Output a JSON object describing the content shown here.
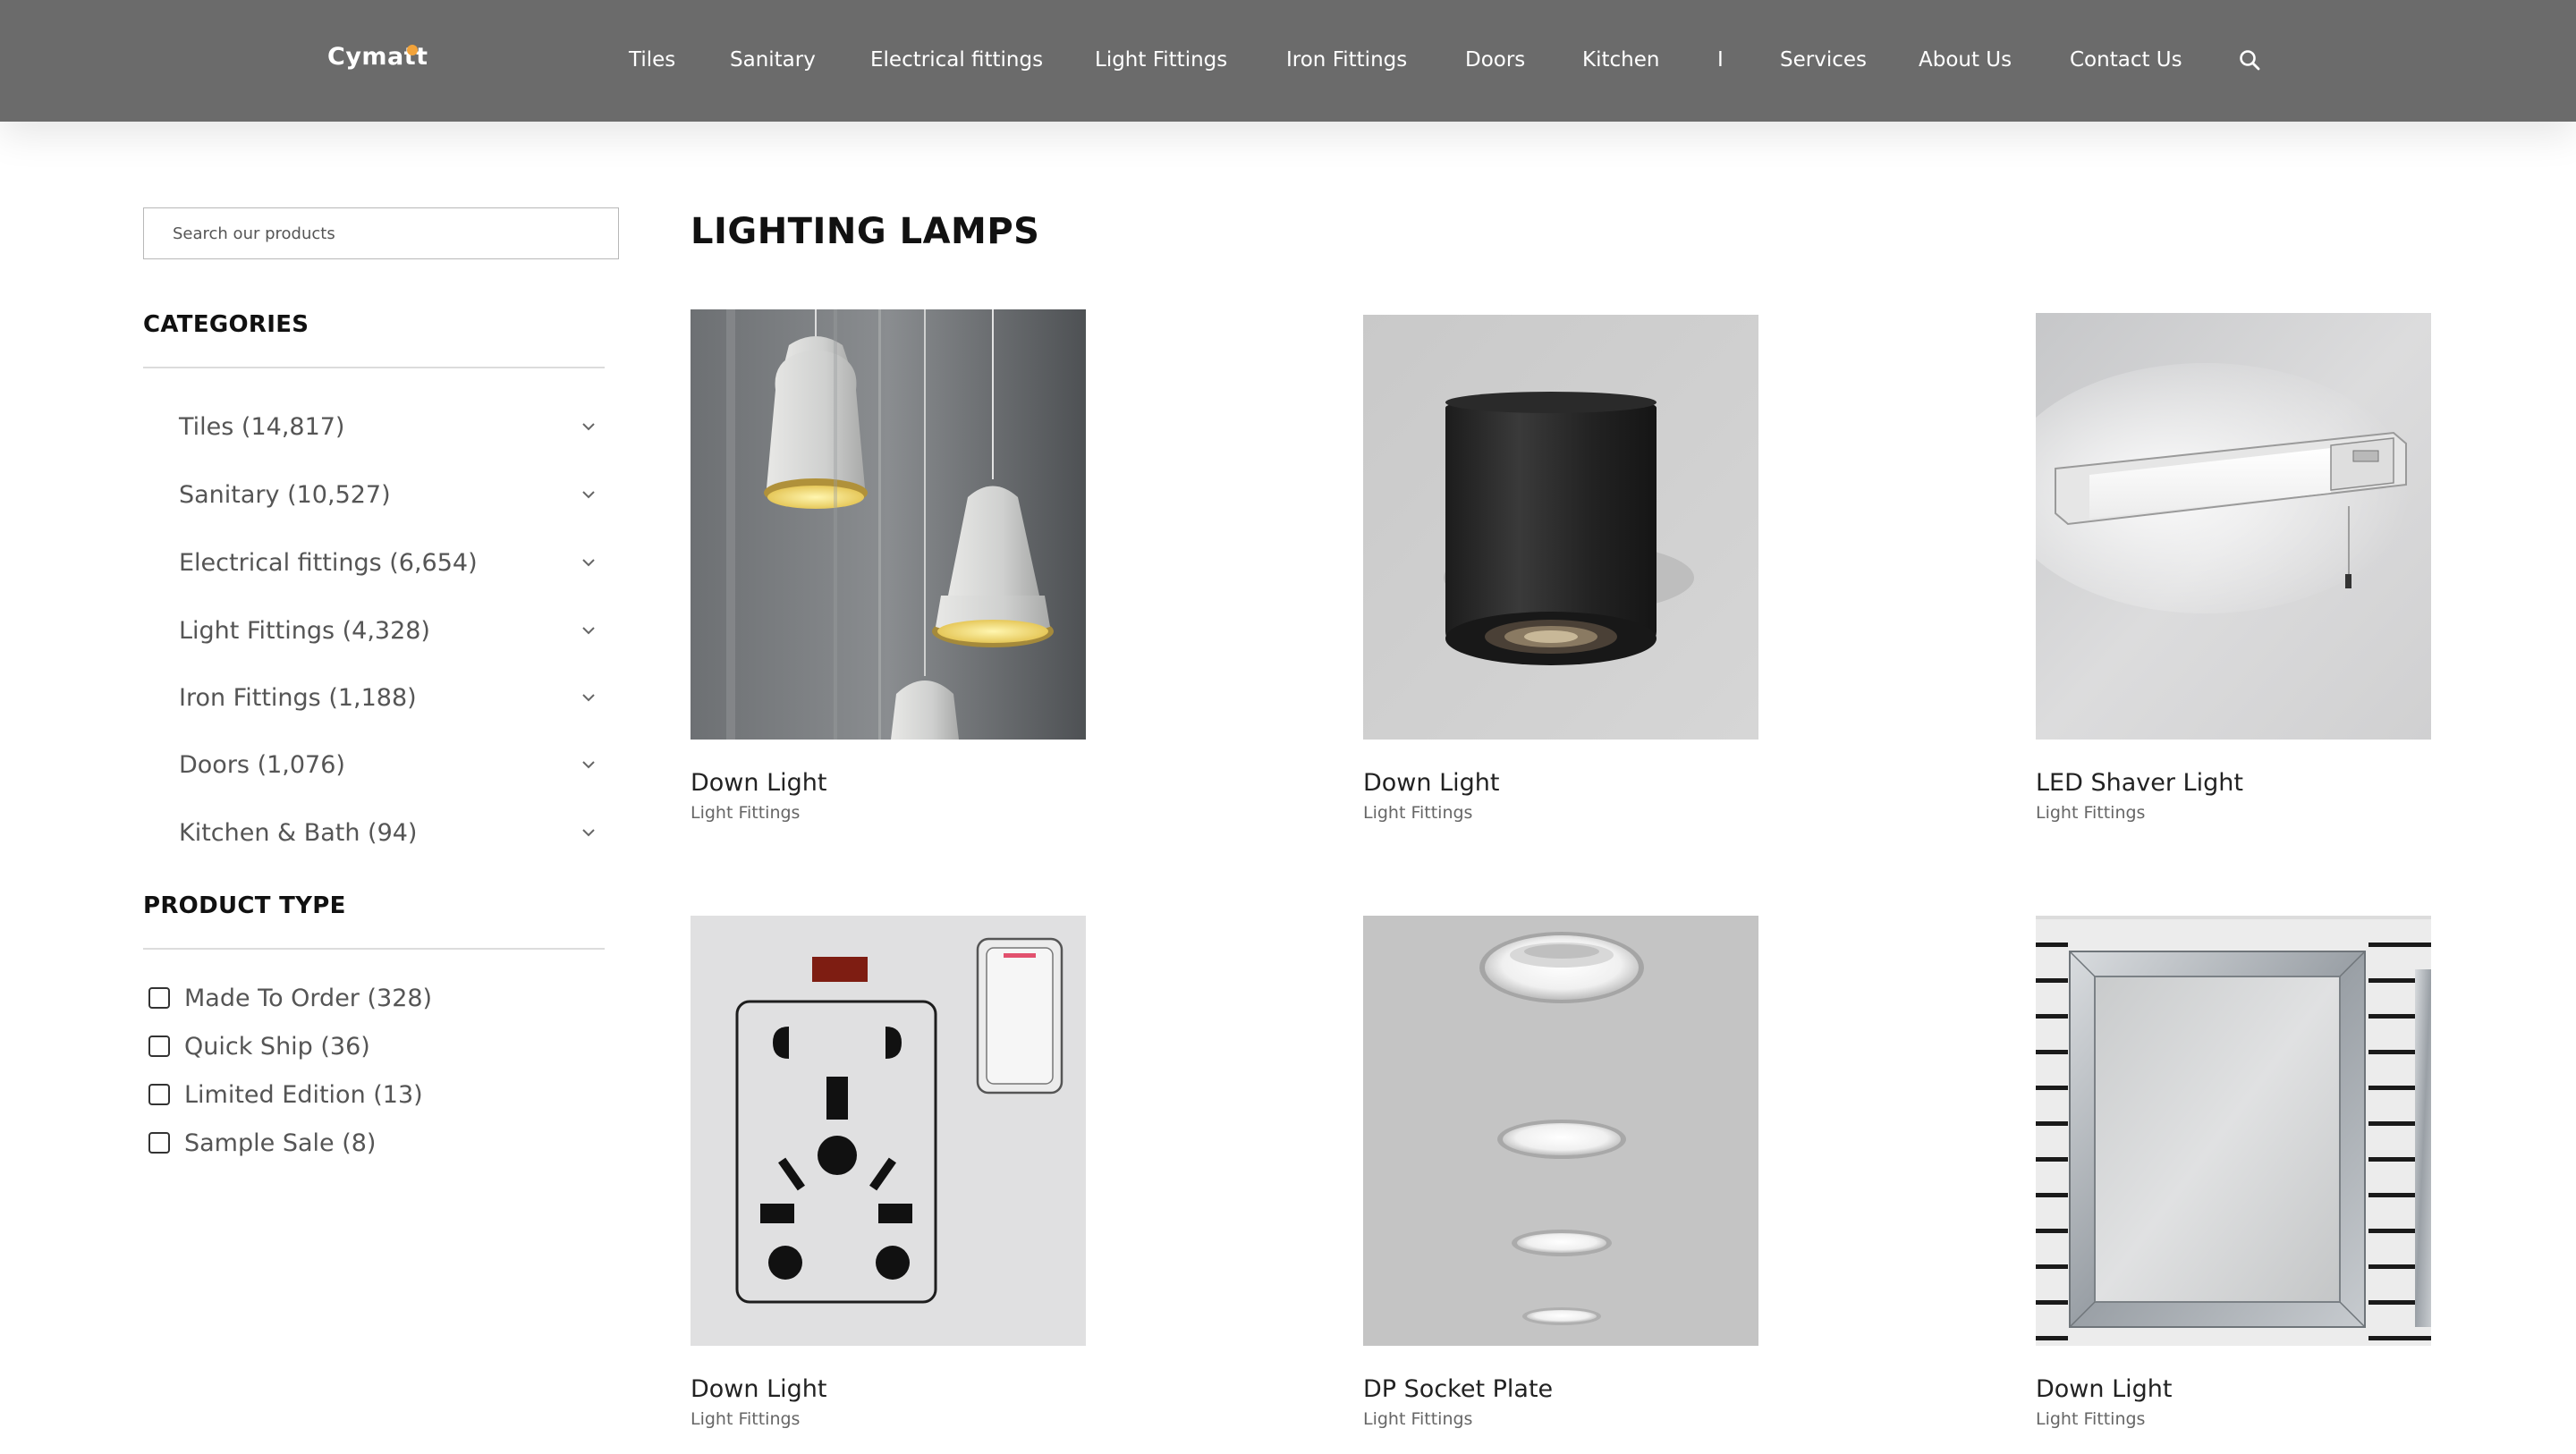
{
  "header": {
    "logo": "Cymatt",
    "nav": [
      "Tiles",
      "Sanitary",
      "Electrical fittings",
      "Light Fittings",
      "Iron Fittings",
      "Doors",
      "Kitchen",
      "I",
      "Services",
      "About Us",
      "Contact Us"
    ],
    "search_icon": "search-icon"
  },
  "sidebar": {
    "search_placeholder": "Search our products",
    "categories_title": "CATEGORIES",
    "categories": [
      {
        "label": "Tiles (14,817)"
      },
      {
        "label": "Sanitary (10,527)"
      },
      {
        "label": "Electrical fittings (6,654)"
      },
      {
        "label": "Light Fittings (4,328)"
      },
      {
        "label": "Iron Fittings (1,188)"
      },
      {
        "label": "Doors (1,076)"
      },
      {
        "label": "Kitchen & Bath (94)"
      }
    ],
    "product_type_title": "PRODUCT TYPE",
    "product_types": [
      {
        "label": "Made To Order (328)",
        "checked": false
      },
      {
        "label": "Quick Ship (36)",
        "checked": false
      },
      {
        "label": "Limited Edition (13)",
        "checked": false
      },
      {
        "label": "Sample Sale (8)",
        "checked": false
      }
    ]
  },
  "main": {
    "title": "LIGHTING LAMPS",
    "products": [
      {
        "name": "Down Light",
        "category": "Light Fittings"
      },
      {
        "name": "Down Light",
        "category": "Light Fittings"
      },
      {
        "name": "LED Shaver Light",
        "category": "Light Fittings"
      },
      {
        "name": "Down Light",
        "category": "Light Fittings"
      },
      {
        "name": "DP Socket Plate",
        "category": "Light Fittings"
      },
      {
        "name": "Down Light",
        "category": "Light Fittings"
      }
    ]
  },
  "colors": {
    "header_bg": "#6b6b6b",
    "logo_accent": "#f2a33a",
    "text_dark": "#111111",
    "text_muted": "#555555"
  }
}
